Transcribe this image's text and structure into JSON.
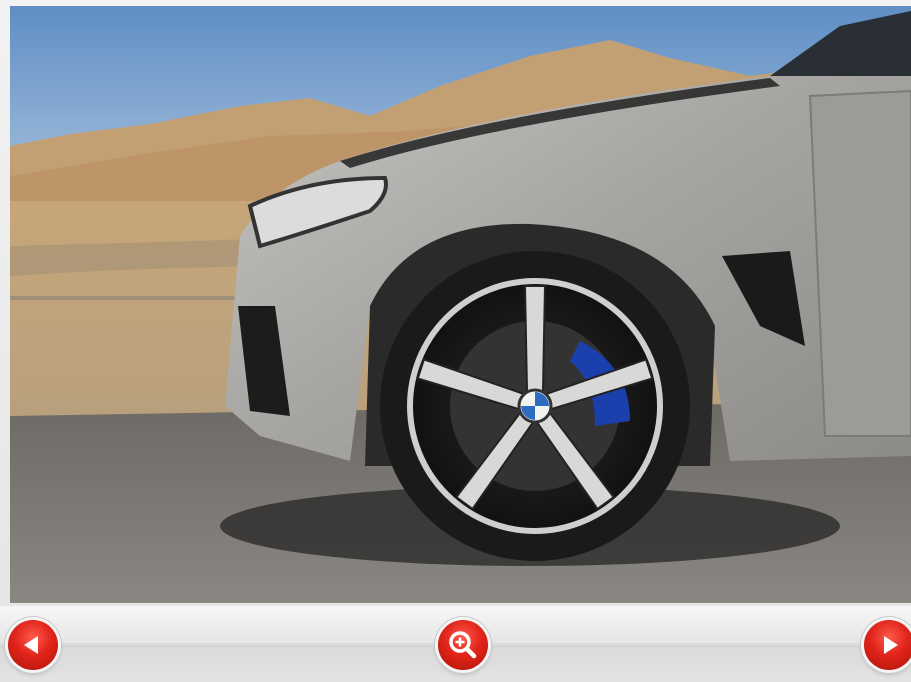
{
  "viewer": {
    "image": {
      "subject": "car-front-wheel-photo"
    },
    "toolbar": {
      "prev_icon": "triangle-left-icon",
      "zoom_icon": "zoom-in-magnifier-icon",
      "next_icon": "triangle-right-icon",
      "accent_color": "#e0241a"
    }
  }
}
